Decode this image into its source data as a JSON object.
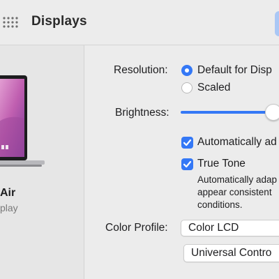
{
  "window": {
    "title": "Displays"
  },
  "toolbar": {
    "grid_icon": "grid-icon"
  },
  "sidebar": {
    "display_name": "Air",
    "display_type": "play"
  },
  "settings": {
    "resolution_label": "Resolution:",
    "resolution_options": [
      "Default for Disp",
      "Scaled"
    ],
    "resolution_selected": "Default for Disp",
    "brightness_label": "Brightness:",
    "brightness_level": 0.95,
    "auto_brightness_label": "Automatically ad",
    "auto_brightness_checked": true,
    "true_tone_label": "True Tone",
    "true_tone_checked": true,
    "true_tone_desc": [
      "Automatically adap",
      "appear consistent",
      "conditions."
    ],
    "color_profile_label": "Color Profile:",
    "color_profile_value": "Color LCD",
    "universal_control_button": "Universal Contro"
  },
  "colors": {
    "accent": "#3478f6",
    "window_bg": "#ececec",
    "sidebar_bg": "#e6e6e6"
  }
}
